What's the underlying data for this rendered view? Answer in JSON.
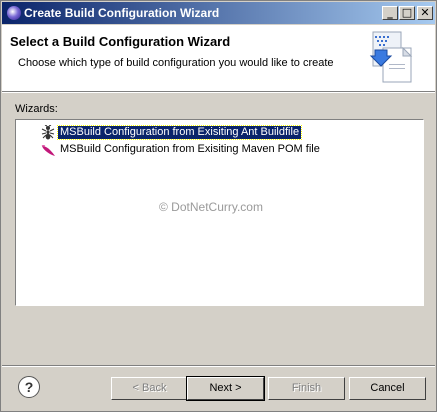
{
  "window": {
    "title": "Create Build Configuration Wizard",
    "minimize_glyph": "_",
    "maximize_glyph": "□",
    "close_glyph": "✕"
  },
  "header": {
    "title": "Select a Build Configuration Wizard",
    "description": "Choose which type of build configuration you would like to create"
  },
  "wizards": {
    "label": "Wizards:",
    "items": [
      {
        "label": "MSBuild Configuration from Exisiting Ant Buildfile",
        "icon": "ant-icon",
        "selected": true
      },
      {
        "label": "MSBuild Configuration from Exisiting Maven POM file",
        "icon": "maven-feather-icon",
        "selected": false
      }
    ]
  },
  "watermark": "© DotNetCurry.com",
  "footer": {
    "help_glyph": "?",
    "back_label": "< Back",
    "next_label": "Next >",
    "finish_label": "Finish",
    "cancel_label": "Cancel"
  },
  "colors": {
    "selection": "#0a246a",
    "titlebar_start": "#0a246a",
    "titlebar_end": "#a6caf0",
    "dialog_bg": "#d4d0c8"
  }
}
